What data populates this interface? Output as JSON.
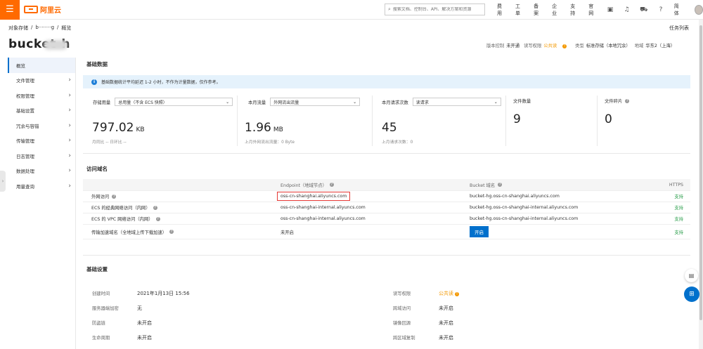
{
  "topbar": {
    "logo_text": "阿里云",
    "search_placeholder": "搜索文档、控制台、API、解决方案和资源",
    "links": [
      "费用",
      "工单",
      "备案",
      "企业",
      "支持",
      "官网"
    ],
    "lang": "简体"
  },
  "breadcrumb": {
    "root": "对象存储",
    "sep1": "/",
    "bucket": "b········g",
    "sep2": "/",
    "current": "概览"
  },
  "task_list": "任务列表",
  "bucket_title": "bucket-h",
  "meta": {
    "versioning_label": "版本控制",
    "versioning_value": "未开通",
    "acl_label": "读写权限",
    "acl_value": "公共读",
    "type_label": "类型",
    "type_value": "标准存储（本地冗余）",
    "region_label": "地域",
    "region_value": "华东2（上海）"
  },
  "sidebar": {
    "items": [
      {
        "label": "概览",
        "active": true,
        "chevron": false
      },
      {
        "label": "文件管理",
        "chevron": true
      },
      {
        "label": "权限管理",
        "chevron": true
      },
      {
        "label": "基础设置",
        "chevron": true
      },
      {
        "label": "冗余与容错",
        "chevron": true
      },
      {
        "label": "传输管理",
        "chevron": true
      },
      {
        "label": "日志管理",
        "chevron": true
      },
      {
        "label": "数据处理",
        "chevron": true
      },
      {
        "label": "用量查询",
        "chevron": true
      }
    ]
  },
  "basic_data": {
    "title": "基础数据",
    "notice": "基础数据统计平均延迟 1-2 小时，不作为计量数据，仅作参考。",
    "stats": [
      {
        "label": "存储用量",
        "select": "总用量（不含 ECS 快照）",
        "value": "797.02",
        "unit": "KB",
        "sub": "月同比 --   日环比 --"
      },
      {
        "label": "本月流量",
        "select": "外网流出流量",
        "value": "1.96",
        "unit": "MB",
        "sub": "上月外网流出流量：0 Byte"
      },
      {
        "label": "本月请求次数",
        "select": "读请求",
        "value": "45",
        "unit": "",
        "sub": "上月请求次数：0"
      },
      {
        "label": "文件数量",
        "value": "9"
      },
      {
        "label": "文件碎片",
        "value": "0"
      }
    ]
  },
  "domains": {
    "title": "访问域名",
    "headers": {
      "endpoint": "Endpoint（地域节点）",
      "bucket_domain": "Bucket 域名",
      "https": "HTTPS"
    },
    "rows": [
      {
        "name": "外网访问",
        "endpoint": "oss-cn-shanghai.aliyuncs.com",
        "bucket": "bucket-hg.oss-cn-shanghai.aliyuncs.com",
        "https": "支持"
      },
      {
        "name": "ECS 的经典网络访问（内网）",
        "endpoint": "oss-cn-shanghai-internal.aliyuncs.com",
        "bucket": "bucket-hg.oss-cn-shanghai-internal.aliyuncs.com",
        "https": "支持"
      },
      {
        "name": "ECS 的 VPC 网络访问（内网）",
        "endpoint": "oss-cn-shanghai-internal.aliyuncs.com",
        "bucket": "bucket-hg.oss-cn-shanghai-internal.aliyuncs.com",
        "https": "支持"
      },
      {
        "name": "传输加速域名（全地域上传下载加速）",
        "endpoint": "未开启",
        "button": "开启",
        "https": "支持"
      }
    ]
  },
  "settings": {
    "title": "基础设置",
    "left": [
      {
        "label": "创建时间",
        "value": "2021年1月13日 15:56"
      },
      {
        "label": "服务器端加密",
        "value": "无"
      },
      {
        "label": "防盗链",
        "value": "未开启"
      },
      {
        "label": "生命周期",
        "value": "未开启"
      }
    ],
    "right": [
      {
        "label": "读写权限",
        "value": "公共读"
      },
      {
        "label": "跨域访问",
        "value": "未开启"
      },
      {
        "label": "镜像回源",
        "value": "未开启"
      },
      {
        "label": "跨区域复制",
        "value": "未开启"
      }
    ]
  },
  "colors": {
    "brand": "#ff6a00",
    "primary": "#0070cc",
    "success": "#2d9f4d",
    "warning": "#f39800",
    "highlight": "#e53935"
  }
}
